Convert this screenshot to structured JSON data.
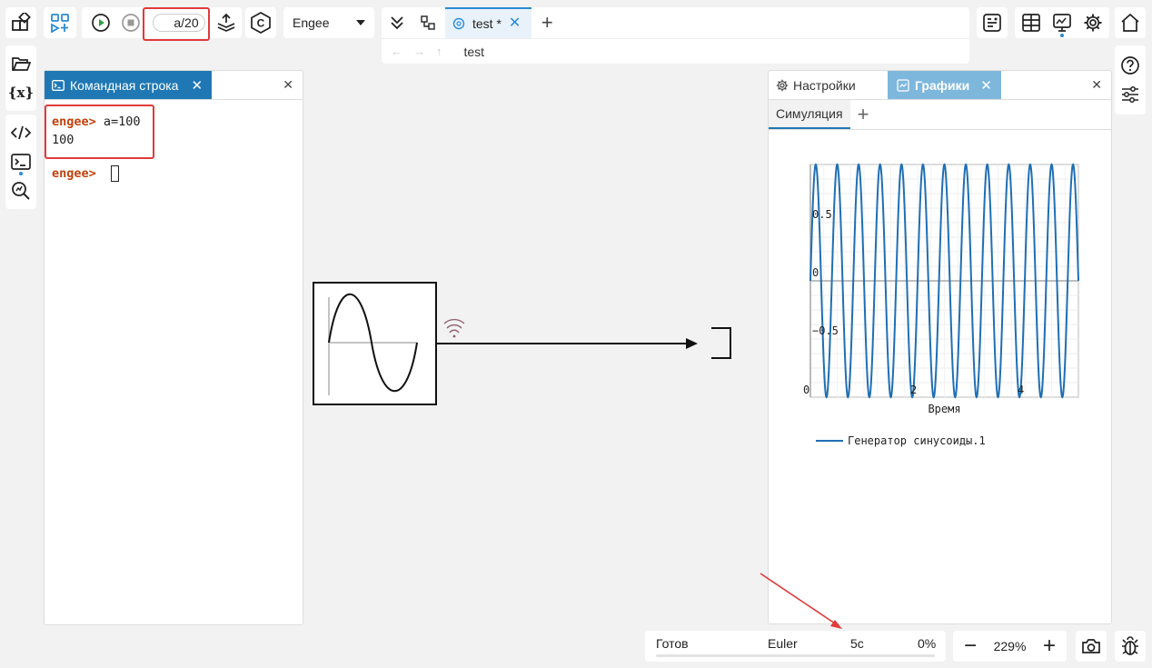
{
  "toolbar": {
    "step_value": "a/20",
    "solver_select": "Engee",
    "tab_title": "test *",
    "breadcrumb": "test"
  },
  "console": {
    "tab_label": "Командная строка",
    "prompt": "engee>",
    "command": " a=100",
    "output": "100",
    "prompt2": "engee>"
  },
  "plots": {
    "settings_tab": "Настройки",
    "plots_tab": "Графики",
    "sim_tab": "Симуляция",
    "y_ticks": [
      "0.5",
      "0",
      "−0.5"
    ],
    "x_ticks": [
      "0",
      "2",
      "4"
    ],
    "xlabel": "Время",
    "legend": "Генератор синусоиды.1",
    "series_color": "#1f6fb4"
  },
  "chart_data": {
    "type": "line",
    "title": "",
    "xlabel": "Время",
    "ylabel": "",
    "xlim": [
      0,
      5
    ],
    "ylim": [
      -1,
      1
    ],
    "series": [
      {
        "name": "Генератор синусоиды.1",
        "function": "sin",
        "cycles": 12.5,
        "amplitude": 1
      }
    ]
  },
  "status": {
    "state": "Готов",
    "solver": "Euler",
    "time": "5с",
    "progress": "0%",
    "progress_value": 0,
    "zoom": "229%"
  }
}
